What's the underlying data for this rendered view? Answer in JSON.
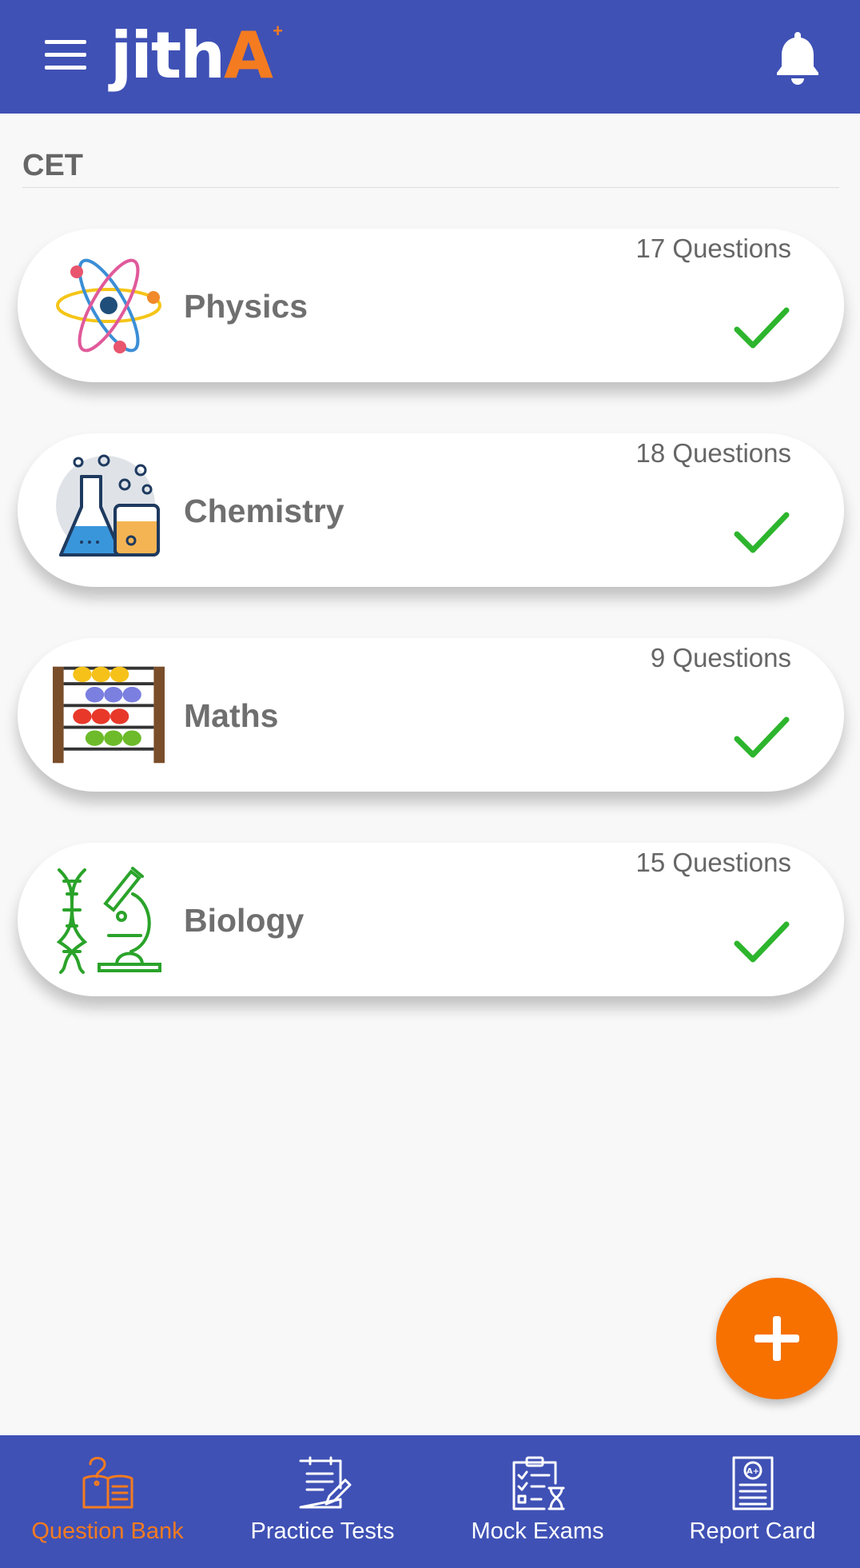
{
  "header": {
    "logo_text": "jith",
    "logo_accent": "A",
    "logo_plus": "+"
  },
  "section": {
    "title": "CET"
  },
  "subjects": [
    {
      "name": "Physics",
      "count_label": "17 Questions",
      "completed": true,
      "icon": "atom-icon"
    },
    {
      "name": "Chemistry",
      "count_label": "18 Questions",
      "completed": true,
      "icon": "flask-icon"
    },
    {
      "name": "Maths",
      "count_label": "9 Questions",
      "completed": true,
      "icon": "abacus-icon"
    },
    {
      "name": "Biology",
      "count_label": "15 Questions",
      "completed": true,
      "icon": "dna-microscope-icon"
    }
  ],
  "fab": {
    "icon": "plus-icon"
  },
  "bottom_nav": {
    "items": [
      {
        "label": "Question Bank",
        "icon": "question-book-icon",
        "active": true
      },
      {
        "label": "Practice Tests",
        "icon": "clipboard-pen-icon",
        "active": false
      },
      {
        "label": "Mock Exams",
        "icon": "checklist-hourglass-icon",
        "active": false
      },
      {
        "label": "Report Card",
        "icon": "report-card-icon",
        "active": false
      }
    ]
  },
  "colors": {
    "primary": "#3f51b5",
    "accent": "#f47b20",
    "fab": "#f67100",
    "check": "#2db52d",
    "background": "#f8f8f8"
  }
}
